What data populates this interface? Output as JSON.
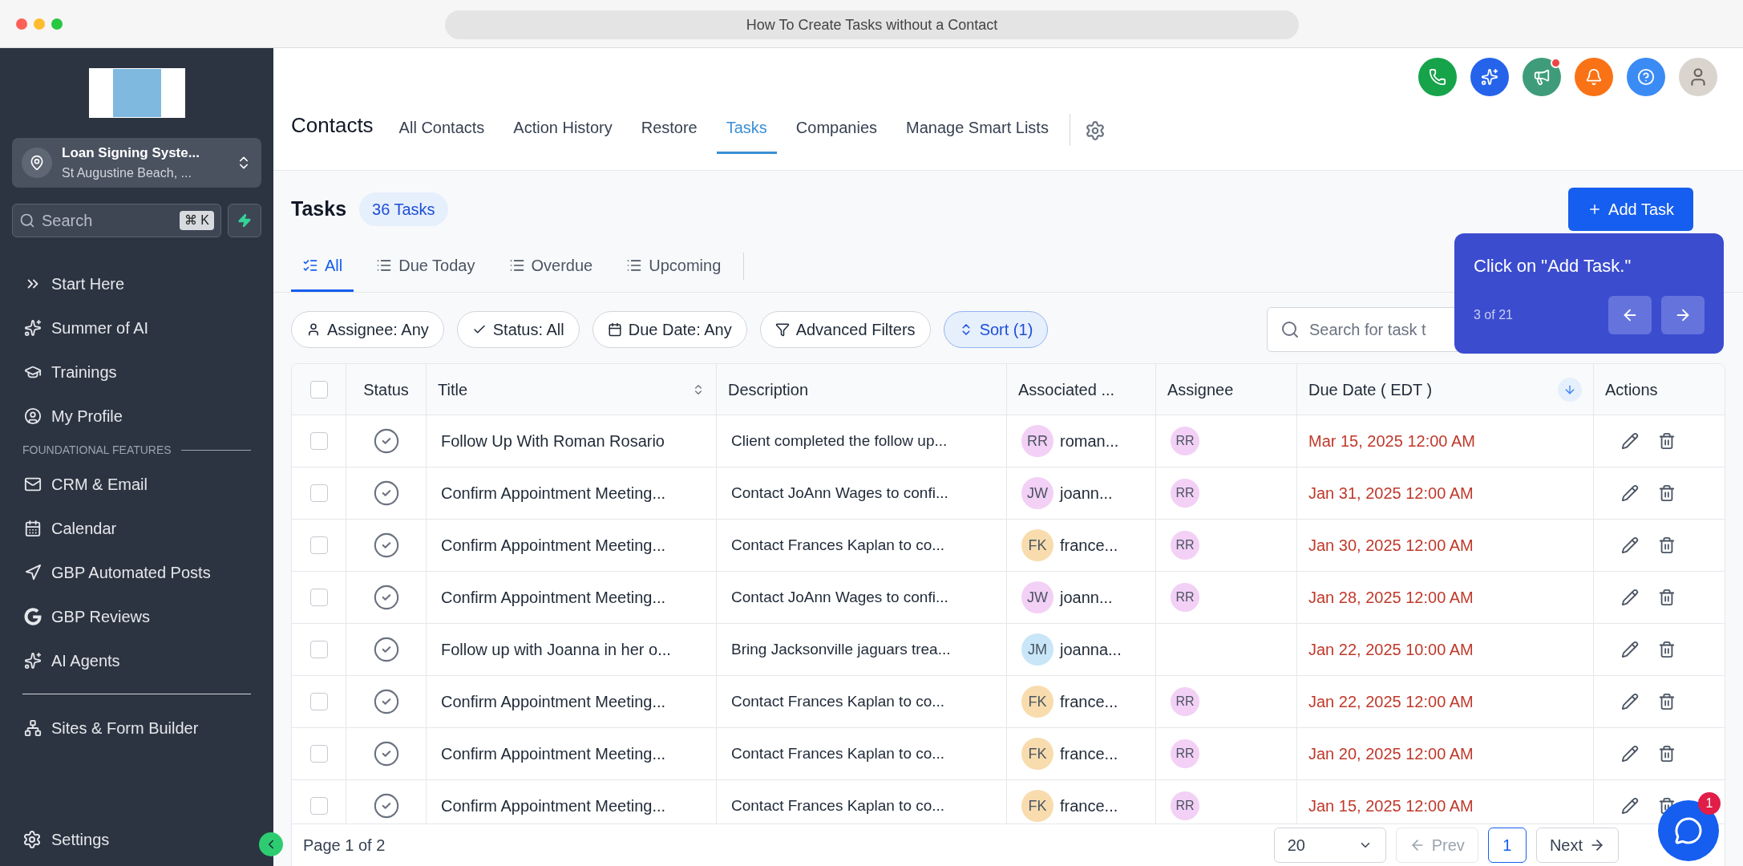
{
  "window": {
    "title": "How To Create Tasks without a Contact"
  },
  "sidebar": {
    "account": {
      "name": "Loan Signing Syste...",
      "location": "St Augustine Beach, ..."
    },
    "search": {
      "placeholder": "Search",
      "shortcut": "⌘ K"
    },
    "items": [
      {
        "label": "Start Here"
      },
      {
        "label": "Summer of AI"
      },
      {
        "label": "Trainings"
      },
      {
        "label": "My Profile"
      }
    ],
    "section": "FOUNDATIONAL FEATURES",
    "section_items": [
      {
        "label": "CRM & Email"
      },
      {
        "label": "Calendar"
      },
      {
        "label": "GBP Automated Posts"
      },
      {
        "label": "GBP Reviews"
      },
      {
        "label": "AI Agents"
      }
    ],
    "bottom_items": [
      {
        "label": "Sites & Form Builder"
      }
    ],
    "settings": "Settings"
  },
  "header": {
    "title": "Contacts",
    "tabs": [
      {
        "label": "All Contacts",
        "selected": false
      },
      {
        "label": "Action History",
        "selected": false
      },
      {
        "label": "Restore",
        "selected": false
      },
      {
        "label": "Tasks",
        "selected": true
      },
      {
        "label": "Companies",
        "selected": false
      },
      {
        "label": "Manage Smart Lists",
        "selected": false
      }
    ],
    "actions": [
      {
        "color": "#16a34a",
        "badge": false
      },
      {
        "color": "#2563eb",
        "badge": false
      },
      {
        "color": "#3f9c7a",
        "badge": true
      },
      {
        "color": "#f97316",
        "badge": false
      },
      {
        "color": "#3b8bf5",
        "badge": false
      }
    ]
  },
  "tasks": {
    "title": "Tasks",
    "count": "36 Tasks",
    "add_button": "Add Task",
    "views": [
      {
        "label": "All",
        "selected": true
      },
      {
        "label": "Due Today",
        "selected": false
      },
      {
        "label": "Overdue",
        "selected": false
      },
      {
        "label": "Upcoming",
        "selected": false
      }
    ],
    "filters": [
      {
        "label": "Assignee: Any",
        "selected": false
      },
      {
        "label": "Status: All",
        "selected": false
      },
      {
        "label": "Due Date: Any",
        "selected": false
      },
      {
        "label": "Advanced Filters",
        "selected": false
      },
      {
        "label": "Sort (1)",
        "selected": true
      }
    ],
    "search_placeholder": "Search for task t",
    "select_all_checked": false,
    "columns": [
      "Status",
      "Title",
      "Description",
      "Associated ...",
      "Assignee",
      "Due Date ( EDT )",
      "Actions"
    ],
    "rows": [
      {
        "checked": false,
        "title": "Follow Up With Roman Rosario",
        "description": "Client completed the follow up...",
        "contact": {
          "initials": "RR",
          "name": "roman...",
          "color": "#f3d0f5"
        },
        "assignee": "RR",
        "due": "Mar 15, 2025 12:00 AM"
      },
      {
        "checked": false,
        "title": "Confirm Appointment Meeting...",
        "description": "Contact JoAnn Wages to confi...",
        "contact": {
          "initials": "JW",
          "name": "joann...",
          "color": "#f3d0f5"
        },
        "assignee": "RR",
        "due": "Jan 31, 2025 12:00 AM"
      },
      {
        "checked": false,
        "title": "Confirm Appointment Meeting...",
        "description": "Contact Frances Kaplan to co...",
        "contact": {
          "initials": "FK",
          "name": "france...",
          "color": "#f8dcae"
        },
        "assignee": "RR",
        "due": "Jan 30, 2025 12:00 AM"
      },
      {
        "checked": false,
        "title": "Confirm Appointment Meeting...",
        "description": "Contact JoAnn Wages to confi...",
        "contact": {
          "initials": "JW",
          "name": "joann...",
          "color": "#f3d0f5"
        },
        "assignee": "RR",
        "due": "Jan 28, 2025 12:00 AM"
      },
      {
        "checked": false,
        "title": "Follow up with Joanna in her o...",
        "description": "Bring Jacksonville jaguars trea...",
        "contact": {
          "initials": "JM",
          "name": "joanna...",
          "color": "#c8e6f8"
        },
        "due": "Jan 22, 2025 10:00 AM"
      },
      {
        "checked": false,
        "title": "Confirm Appointment Meeting...",
        "description": "Contact Frances Kaplan to co...",
        "contact": {
          "initials": "FK",
          "name": "france...",
          "color": "#f8dcae"
        },
        "assignee": "RR",
        "due": "Jan 22, 2025 12:00 AM"
      },
      {
        "checked": false,
        "title": "Confirm Appointment Meeting...",
        "description": "Contact Frances Kaplan to co...",
        "contact": {
          "initials": "FK",
          "name": "france...",
          "color": "#f8dcae"
        },
        "assignee": "RR",
        "due": "Jan 20, 2025 12:00 AM"
      },
      {
        "checked": false,
        "title": "Confirm Appointment Meeting...",
        "description": "Contact Frances Kaplan to co...",
        "contact": {
          "initials": "FK",
          "name": "france...",
          "color": "#f8dcae"
        },
        "assignee": "RR",
        "due": "Jan 15, 2025 12:00 AM"
      }
    ],
    "pagination": {
      "page": "Page 1 of 2",
      "per_page": "20",
      "prev": "Prev",
      "current": "1",
      "next": "Next"
    }
  },
  "guide": {
    "text": "Click on \"Add Task.\"",
    "step": "3 of 21"
  },
  "chat": {
    "badge": "1"
  }
}
